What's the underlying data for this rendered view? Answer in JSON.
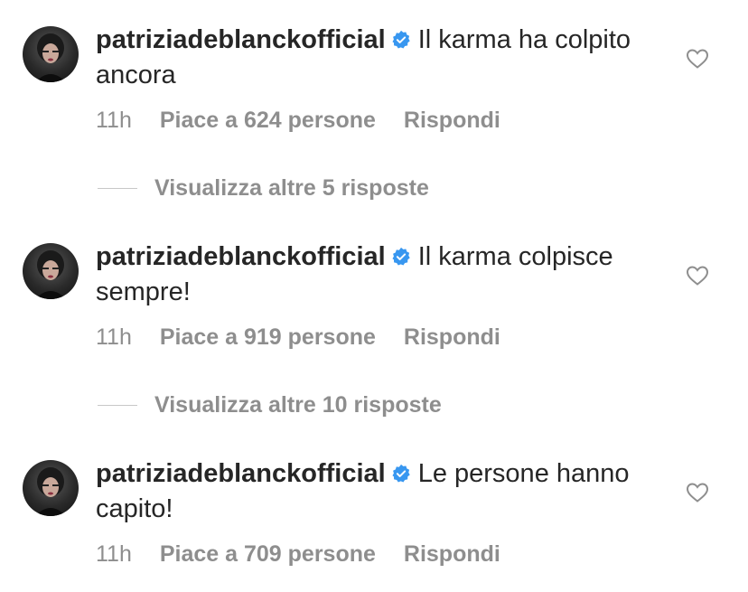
{
  "comments": [
    {
      "username": "patriziadeblanckofficial",
      "text": "Il karma ha colpito ancora",
      "time": "11h",
      "likes": "Piace a 624 persone",
      "reply": "Rispondi",
      "view_replies": "Visualizza altre 5 risposte"
    },
    {
      "username": "patriziadeblanckofficial",
      "text": "Il karma colpisce sempre!",
      "time": "11h",
      "likes": "Piace a 919 persone",
      "reply": "Rispondi",
      "view_replies": "Visualizza altre 10 risposte"
    },
    {
      "username": "patriziadeblanckofficial",
      "text": "Le persone hanno capito!",
      "time": "11h",
      "likes": "Piace a 709 persone",
      "reply": "Rispondi"
    }
  ],
  "colors": {
    "text": "#262626",
    "meta": "#8e8e8e",
    "verified": "#3897f0"
  },
  "icons": {
    "avatar": "avatar-photo",
    "verified": "verified-badge-icon",
    "like": "heart-outline-icon"
  }
}
